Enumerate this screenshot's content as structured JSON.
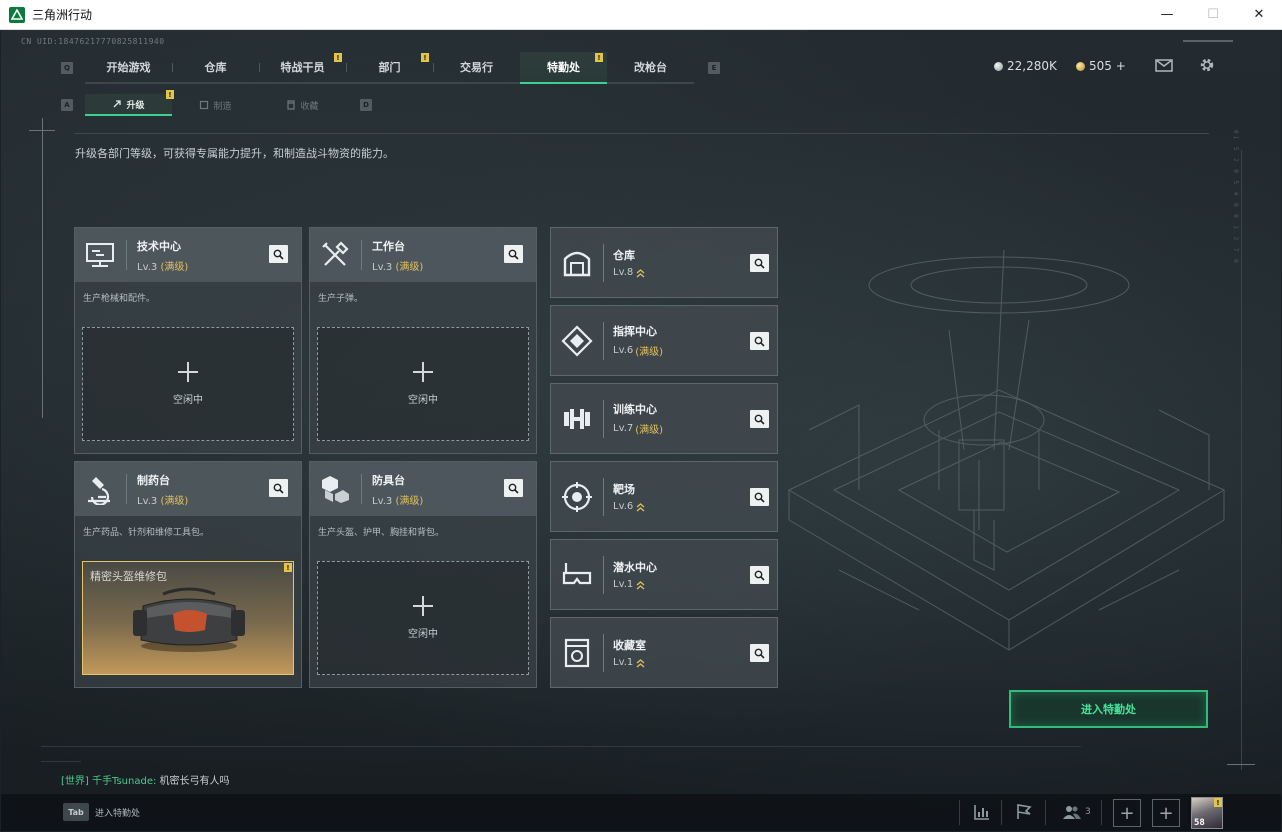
{
  "window": {
    "title": "三角洲行动",
    "minimize_glyph": "—",
    "maximize_glyph": "☐",
    "close_glyph": "✕"
  },
  "uid": "CN UID:1847621777082581194​0",
  "nav": {
    "left_key": "Q",
    "right_key": "E",
    "tabs": [
      {
        "label": "开始游戏",
        "alert": ""
      },
      {
        "label": "仓库",
        "alert": ""
      },
      {
        "label": "特战干员",
        "alert": "!"
      },
      {
        "label": "部门",
        "alert": "!"
      },
      {
        "label": "交易行",
        "alert": ""
      },
      {
        "label": "特勤处",
        "alert": "!",
        "active": true
      },
      {
        "label": "改枪台",
        "alert": ""
      }
    ]
  },
  "currency": {
    "silver": "22,280K",
    "gold": "505 +"
  },
  "top_icons": [
    "mail-icon",
    "gear-icon"
  ],
  "subnav": {
    "left_key": "A",
    "right_key": "D",
    "tabs": [
      {
        "label": "升级",
        "icon": "upgrade-icon",
        "active": true,
        "alert": "!"
      },
      {
        "label": "制造",
        "icon": "craft-icon"
      },
      {
        "label": "收藏",
        "icon": "collect-icon"
      }
    ]
  },
  "page_description": "升级各部门等级，可获得专属能力提升，和制造战斗物资的能力。",
  "stations": [
    {
      "name": "技术中心",
      "level": "Lv.3",
      "max": "(满级)",
      "desc": "生产枪械和配件。",
      "slot": "空闲中",
      "icon": "computer-icon"
    },
    {
      "name": "工作台",
      "level": "Lv.3",
      "max": "(满级)",
      "desc": "生产子弹。",
      "slot": "空闲中",
      "icon": "tools-icon"
    },
    {
      "name": "制药台",
      "level": "Lv.3",
      "max": "(满级)",
      "desc": "生产药品、针剂和维修工具包。",
      "slot_item": "精密头盔维修包",
      "slot_alert": "!",
      "icon": "microscope-icon"
    },
    {
      "name": "防具台",
      "level": "Lv.3",
      "max": "(满级)",
      "desc": "生产头盔、护甲、胸挂和背包。",
      "slot": "空闲中",
      "icon": "cubes-icon"
    }
  ],
  "facilities": [
    {
      "name": "仓库",
      "level": "Lv.8",
      "max": "",
      "upgradable": true,
      "icon": "warehouse-icon"
    },
    {
      "name": "指挥中心",
      "level": "Lv.6",
      "max": "(满级)",
      "upgradable": false,
      "icon": "command-icon"
    },
    {
      "name": "训练中心",
      "level": "Lv.7",
      "max": "(满级)",
      "upgradable": false,
      "icon": "dumbbell-icon"
    },
    {
      "name": "靶场",
      "level": "Lv.6",
      "max": "",
      "upgradable": true,
      "icon": "target-icon"
    },
    {
      "name": "潜水中心",
      "level": "Lv.1",
      "max": "",
      "upgradable": true,
      "icon": "dive-mask-icon"
    },
    {
      "name": "收藏室",
      "level": "Lv.1",
      "max": "",
      "upgradable": true,
      "icon": "collection-icon"
    }
  ],
  "enter_button": "进入特勤处",
  "chat": {
    "channel": "[世界]",
    "user": "千手Tsunade:",
    "message": "机密长弓有人吗"
  },
  "bottom": {
    "tab_key": "Tab",
    "tab_label": "进入特勤处",
    "friend_count": "3",
    "avatar_level": "58",
    "avatar_alert": "!",
    "plus": "+"
  },
  "colors": {
    "accent": "#3fcf8e",
    "max_level": "#e0c05a",
    "alert": "#e3c44a"
  }
}
